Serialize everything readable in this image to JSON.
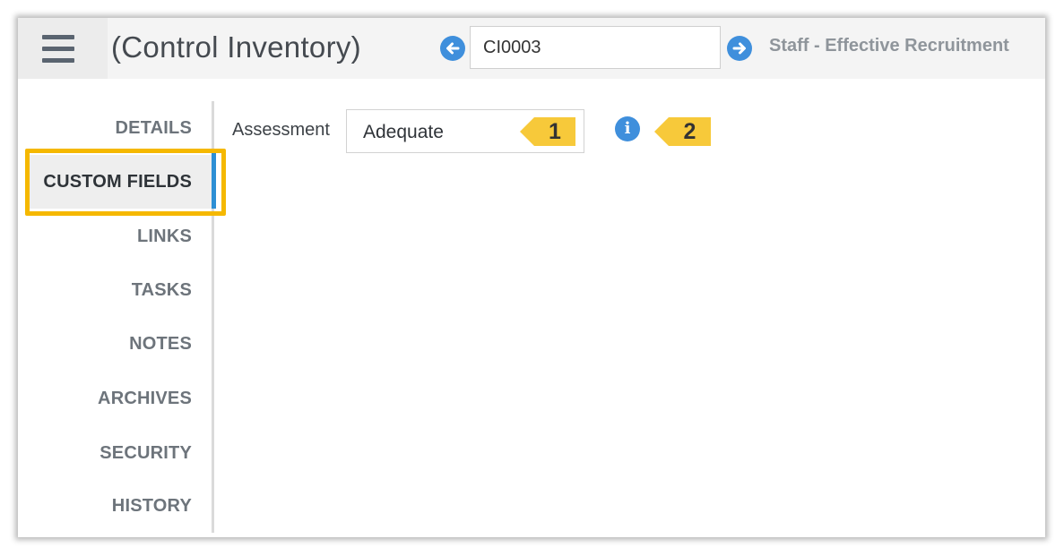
{
  "header": {
    "app_title": "(Control Inventory)",
    "record_id": "CI0003",
    "record_name": "Staff - Effective Recruitment"
  },
  "sidebar": {
    "items": [
      {
        "label": "DETAILS",
        "active": false
      },
      {
        "label": "CUSTOM FIELDS",
        "active": true
      },
      {
        "label": "LINKS",
        "active": false
      },
      {
        "label": "TASKS",
        "active": false
      },
      {
        "label": "NOTES",
        "active": false
      },
      {
        "label": "ARCHIVES",
        "active": false
      },
      {
        "label": "SECURITY",
        "active": false
      },
      {
        "label": "HISTORY",
        "active": false
      }
    ]
  },
  "content": {
    "assessment_label": "Assessment",
    "assessment_value": "Adequate",
    "info_icon": "i"
  },
  "callouts": {
    "first": "1",
    "second": "2"
  },
  "icons": {
    "menu": "hamburger-menu-icon",
    "prev": "arrow-left-circle-icon",
    "next": "arrow-right-circle-icon",
    "info": "info-circle-icon"
  },
  "colors": {
    "accent": "#3f8fdc",
    "active_indicator": "#2d8fd5",
    "highlight": "#f5b800",
    "callout": "#f7c93a"
  }
}
